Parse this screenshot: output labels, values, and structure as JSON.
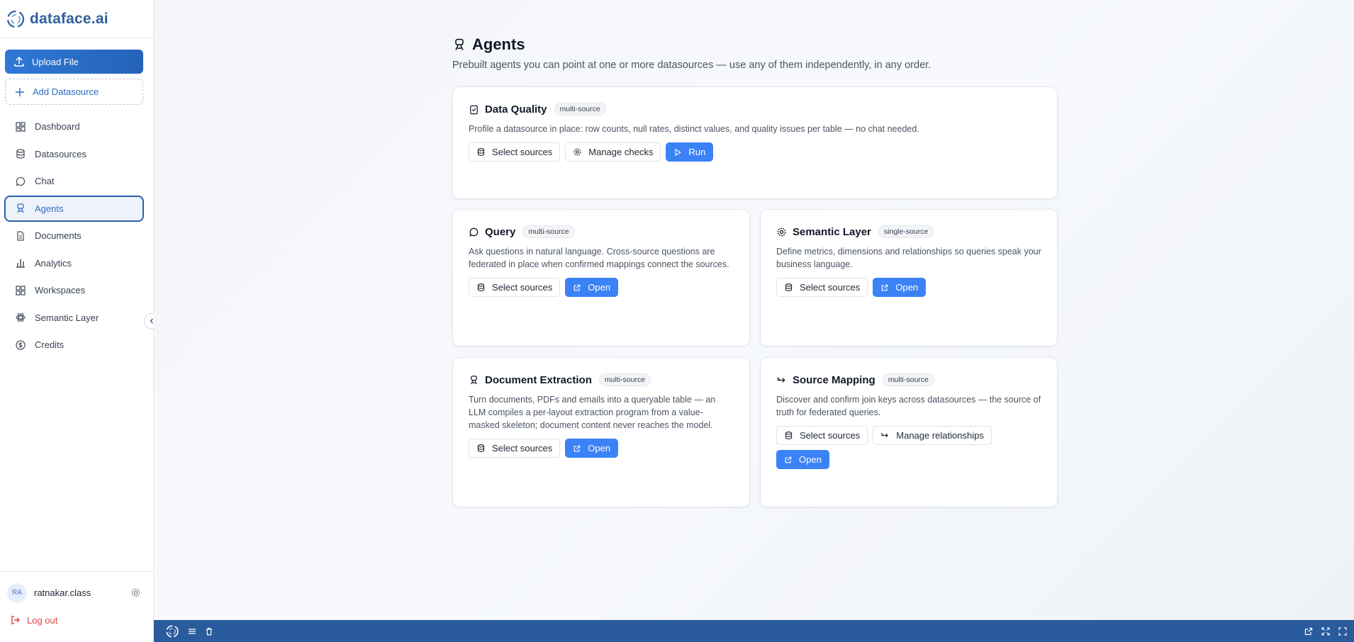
{
  "brand": {
    "name": "dataface.ai"
  },
  "sidebar": {
    "upload_label": "Upload File",
    "add_label": "Add Datasource",
    "items": [
      {
        "label": "Dashboard",
        "icon": "dashboard-icon"
      },
      {
        "label": "Datasources",
        "icon": "database-icon"
      },
      {
        "label": "Chat",
        "icon": "chat-icon"
      },
      {
        "label": "Agents",
        "icon": "agent-icon",
        "active": true
      },
      {
        "label": "Documents",
        "icon": "document-icon"
      },
      {
        "label": "Analytics",
        "icon": "bar-chart-icon"
      },
      {
        "label": "Workspaces",
        "icon": "grid-icon"
      },
      {
        "label": "Semantic Layer",
        "icon": "atom-icon"
      },
      {
        "label": "Credits",
        "icon": "dollar-icon"
      }
    ]
  },
  "user": {
    "initials": "RA",
    "name": "ratnakar.class"
  },
  "logout_label": "Log out",
  "page": {
    "title": "Agents",
    "subtitle": "Prebuilt agents you can point at one or more datasources — use any of them independently, in any order."
  },
  "cards": {
    "data_quality": {
      "title": "Data Quality",
      "badge": "multi-source",
      "desc": "Profile a datasource in place: row counts, null rates, distinct values, and quality issues per table — no chat needed.",
      "select": "Select sources",
      "manage": "Manage checks",
      "run": "Run"
    },
    "query": {
      "title": "Query",
      "badge": "multi-source",
      "desc": "Ask questions in natural language. Cross-source questions are federated in place when confirmed mappings connect the sources.",
      "select": "Select sources",
      "open": "Open"
    },
    "semantic": {
      "title": "Semantic Layer",
      "badge": "single-source",
      "desc": "Define metrics, dimensions and relationships so queries speak your business language.",
      "select": "Select sources",
      "open": "Open"
    },
    "doc_extraction": {
      "title": "Document Extraction",
      "badge": "multi-source",
      "desc": "Turn documents, PDFs and emails into a queryable table — an LLM compiles a per-layout extraction program from a value-masked skeleton; document content never reaches the model.",
      "select": "Select sources",
      "open": "Open"
    },
    "source_mapping": {
      "title": "Source Mapping",
      "badge": "multi-source",
      "desc": "Discover and confirm join keys across datasources — the source of truth for federated queries.",
      "select": "Select sources",
      "manage": "Manage relationships",
      "open": "Open"
    }
  },
  "colors": {
    "primary": "#3b82f6",
    "brand": "#2f5f9e",
    "bottom_bar": "#2a5b9c",
    "logout": "#e04646"
  }
}
